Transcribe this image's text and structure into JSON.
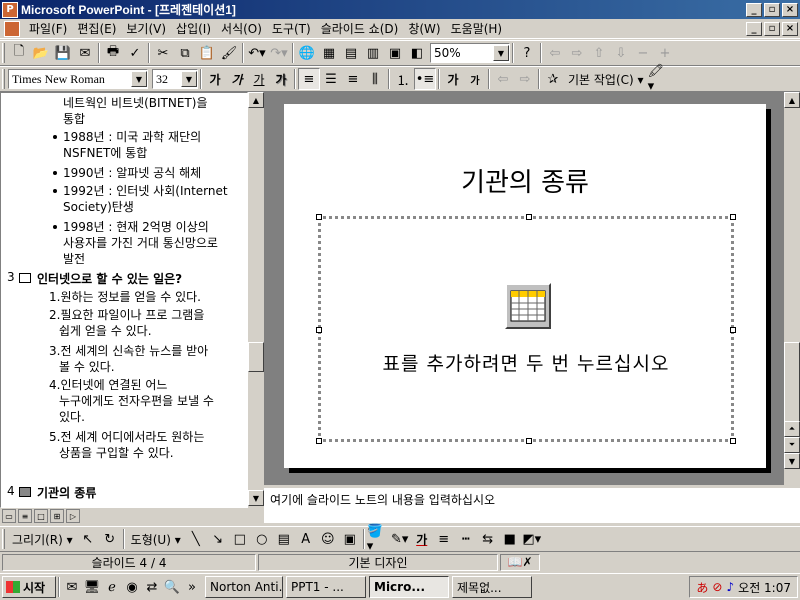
{
  "window": {
    "title": "Microsoft PowerPoint - [프레젠테이션1]"
  },
  "menu": [
    "파일(F)",
    "편집(E)",
    "보기(V)",
    "삽입(I)",
    "서식(O)",
    "도구(T)",
    "슬라이드 쇼(D)",
    "창(W)",
    "도움말(H)"
  ],
  "standard_toolbar": {
    "zoom": "50%"
  },
  "formatting_toolbar": {
    "font_name": "Times New Roman",
    "font_size": "32",
    "bold": "가",
    "italic": "가",
    "underline": "가",
    "shadow": "가",
    "increase_font": "가",
    "decrease_font": "가",
    "common_tasks": "기본 작업(C) ▾"
  },
  "outline": {
    "lines": [
      "네트웍인 비트넷(BITNET)을",
      "통합",
      "1988년 : 미국 과학 재단의",
      "NSFNET에 통합",
      "1990년 : 알파넷 공식 해체",
      "1992년 : 인터넷 사회(Internet",
      "Society)탄생",
      "1998년 : 현재 2억명 이상의",
      "사용자를 가진 거대 통신망으로",
      "발전"
    ],
    "slide3": {
      "num": "3",
      "title": "인터넷으로 할 수 있는 일은?",
      "items": [
        "1.원하는 정보를 얻을 수 있다.",
        "2.필요한  파일이나 프로 그램을",
        "쉽게 얻을 수 있다.",
        "3.전 세계의 신속한 뉴스를 받아",
        "볼 수 있다.",
        "4.인터넷에 연결된 어느",
        "누구에게도 전자우편을 보낼 수",
        "있다.",
        "5.전 세계 어디에서라도 원하는",
        "상품을 구입할 수 있다."
      ]
    },
    "slide4": {
      "num": "4",
      "title": "기관의 종류"
    }
  },
  "slide": {
    "title": "기관의 종류",
    "placeholder": "표를 추가하려면 두 번 누르십시오"
  },
  "notes_placeholder": "여기에 슬라이드 노트의 내용을 입력하십시오",
  "drawing_toolbar": {
    "draw": "그리기(R) ▾",
    "autoshapes": "도형(U) ▾",
    "font_color": "가"
  },
  "status": {
    "slide": "슬라이드 4 / 4",
    "design": "기본 디자인"
  },
  "taskbar": {
    "start": "시작",
    "tasks": [
      "Norton Anti...",
      "PPT1 - ...",
      "Micro...",
      "제목없..."
    ],
    "clock": "오전 1:07"
  },
  "colors": {
    "title_bar": "#0a246a",
    "face": "#d4d0c8",
    "slide_bg": "#808080"
  }
}
